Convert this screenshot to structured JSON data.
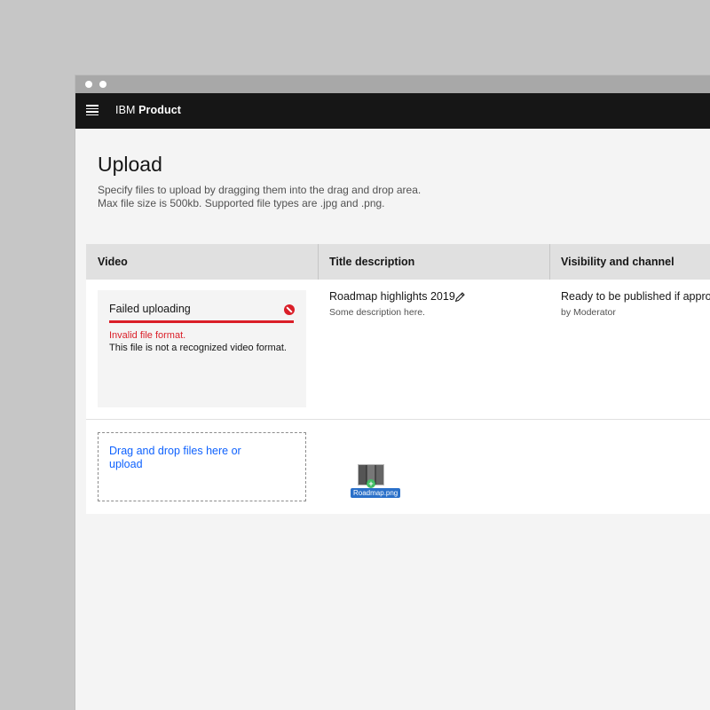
{
  "app": {
    "brand_prefix": "IBM",
    "brand_name": "Product"
  },
  "page": {
    "title": "Upload",
    "helper_line1": "Specify files to upload by dragging them into the drag and drop area.",
    "helper_line2": "Max file size is 500kb. Supported file types are .jpg and .png."
  },
  "table": {
    "headers": [
      "Video",
      "Title description",
      "Visibility and channel"
    ],
    "row1": {
      "video": {
        "status": "Failed uploading",
        "error_title": "Invalid file format.",
        "error_desc": "This file is not a recognized video format."
      },
      "title": "Roadmap highlights 2019",
      "description": "Some description here.",
      "visibility": "Ready to be published if approved",
      "channel": "by Moderator"
    },
    "dropzone_label": "Drag and drop files here or upload"
  },
  "drag": {
    "filename": "Roadmap.png"
  },
  "icons": {
    "menu": "hamburger-icon",
    "error": "error-filled-icon",
    "edit": "pencil-icon",
    "thumbnail": "file-thumbnail-icon",
    "add": "plus-icon"
  },
  "colors": {
    "accent": "#0f62fe",
    "error": "#da1e28",
    "header": "#161616"
  }
}
